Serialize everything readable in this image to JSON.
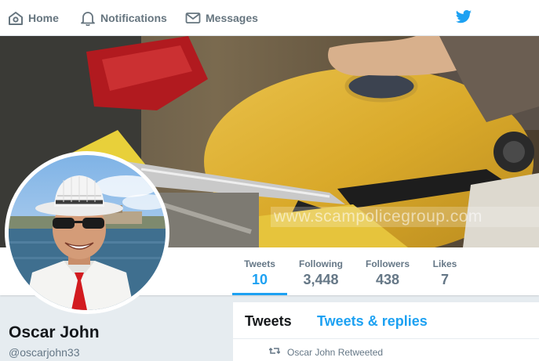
{
  "nav": {
    "home_label": "Home",
    "notifications_label": "Notifications",
    "messages_label": "Messages"
  },
  "banner": {
    "watermark": "www.scampolicegroup.com"
  },
  "stats": [
    {
      "label": "Tweets",
      "value": "10"
    },
    {
      "label": "Following",
      "value": "3,448"
    },
    {
      "label": "Followers",
      "value": "438"
    },
    {
      "label": "Likes",
      "value": "7"
    }
  ],
  "profile": {
    "name": "Oscar John",
    "handle": "@oscarjohn33"
  },
  "timeline": {
    "tabs": [
      "Tweets",
      "Tweets & replies"
    ],
    "retweet_label": "Oscar John Retweeted"
  },
  "colors": {
    "accent": "#1da1f2",
    "muted": "#657786",
    "background": "#e6ecf0"
  },
  "icons": [
    "home-icon",
    "bell-icon",
    "envelope-icon",
    "twitter-bird-icon",
    "retweet-icon"
  ]
}
